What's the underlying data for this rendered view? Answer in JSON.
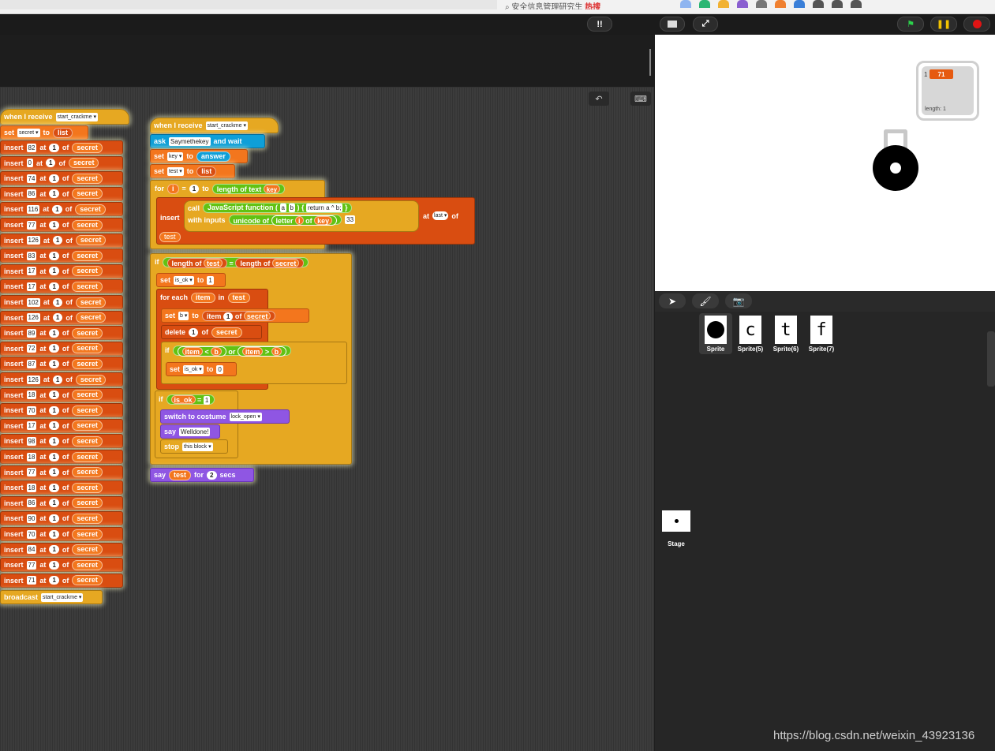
{
  "browser": {
    "search_text": "安全信息管理研究生",
    "search_hot": "热搜"
  },
  "topbar": {
    "stage_mode_icon": "stage-size-icon",
    "flag_icon": "green-flag-icon",
    "pause_icon": "pause-icon",
    "stop_icon": "stop-icon"
  },
  "script_area": {
    "undo_label": "↶",
    "keyboard_label": "⌨"
  },
  "left_script": {
    "hat_label": "when I receive",
    "hat_message": "start_crackme",
    "set_label": "set",
    "set_var": "secret",
    "set_to": "to",
    "set_value": "list",
    "insert_label": "insert",
    "at_label": "at",
    "index": "1",
    "of_label": "of",
    "list_var": "secret",
    "values": [
      "82",
      "0",
      "74",
      "86",
      "116",
      "77",
      "126",
      "83",
      "17",
      "17",
      "102",
      "126",
      "89",
      "72",
      "87",
      "126",
      "18",
      "70",
      "17",
      "98",
      "18",
      "77",
      "18",
      "86",
      "90",
      "70",
      "84",
      "77",
      "71"
    ],
    "broadcast_label": "broadcast",
    "broadcast_message": "start_crackme"
  },
  "right_script": {
    "hat_label": "when I receive",
    "hat_message": "start_crackme",
    "ask_label": "ask",
    "ask_prompt": "Saymethekey",
    "ask_wait": "and wait",
    "set1_label": "set",
    "set1_var": "key",
    "set1_to": "to",
    "set1_value": "answer",
    "set2_label": "set",
    "set2_var": "test",
    "set2_to": "to",
    "set2_value": "list",
    "for_label": "for",
    "for_var": "i",
    "for_eq": "=",
    "for_start": "1",
    "for_to": "to",
    "for_length": "length of text",
    "for_key": "key",
    "insert_label": "insert",
    "call_label": "call",
    "js_label": "JavaScript function",
    "js_param_a": "a",
    "js_param_b": "b",
    "js_body": "return a ^ b;",
    "with_inputs": "with inputs",
    "unicode_of": "unicode of",
    "letter_label": "letter",
    "letter_i": "i",
    "letter_of": "of",
    "letter_key": "key",
    "xor_value": "33",
    "at_label": "at",
    "at_value": "last",
    "of_label": "of",
    "insert_target": "test",
    "if1_label": "if",
    "length_of_1": "length of",
    "len_var_1": "test",
    "eq": "=",
    "length_of_2": "length of",
    "len_var_2": "secret",
    "set_isok_label": "set",
    "set_isok_var": "is_ok",
    "set_isok_to": "to",
    "set_isok_value": "1",
    "foreach_label": "for each",
    "foreach_var": "item",
    "foreach_in": "in",
    "foreach_list": "test",
    "setb_label": "set",
    "setb_var": "b",
    "setb_to": "to",
    "setb_item": "item",
    "setb_index": "1",
    "setb_of": "of",
    "setb_list": "secret",
    "delete_label": "delete",
    "delete_index": "1",
    "delete_of": "of",
    "delete_list": "secret",
    "if2_label": "if",
    "cmp_item_1": "item",
    "lt": "<",
    "cmp_b_1": "b",
    "or_label": "or",
    "cmp_item_2": "item",
    "gt": ">",
    "cmp_b_2": "b",
    "set_isok0_label": "set",
    "set_isok0_var": "is_ok",
    "set_isok0_to": "to",
    "set_isok0_value": "0",
    "if3_label": "if",
    "isok_var": "is_ok",
    "isok_eq": "=",
    "isok_val": "1",
    "switch_label": "switch to costume",
    "switch_costume": "lock_open",
    "say_label": "say",
    "say_text": "Welldone!",
    "stop_label": "stop",
    "stop_option": "this block",
    "sayfor_label": "say",
    "sayfor_var": "test",
    "sayfor_for": "for",
    "sayfor_secs_value": "2",
    "sayfor_secs": "secs"
  },
  "stage": {
    "watcher_index": "1",
    "watcher_value": "71",
    "watcher_length": "length: 1"
  },
  "corral": {
    "tools": [
      "➤",
      "🖌",
      "📷"
    ],
    "sprites": [
      {
        "name": "Sprite",
        "glyph": "🔒"
      },
      {
        "name": "Sprite(5)",
        "glyph": "c"
      },
      {
        "name": "Sprite(6)",
        "glyph": "t"
      },
      {
        "name": "Sprite(7)",
        "glyph": "f"
      }
    ],
    "stage_label": "Stage"
  },
  "watermark": "https://blog.csdn.net/weixin_43923136"
}
